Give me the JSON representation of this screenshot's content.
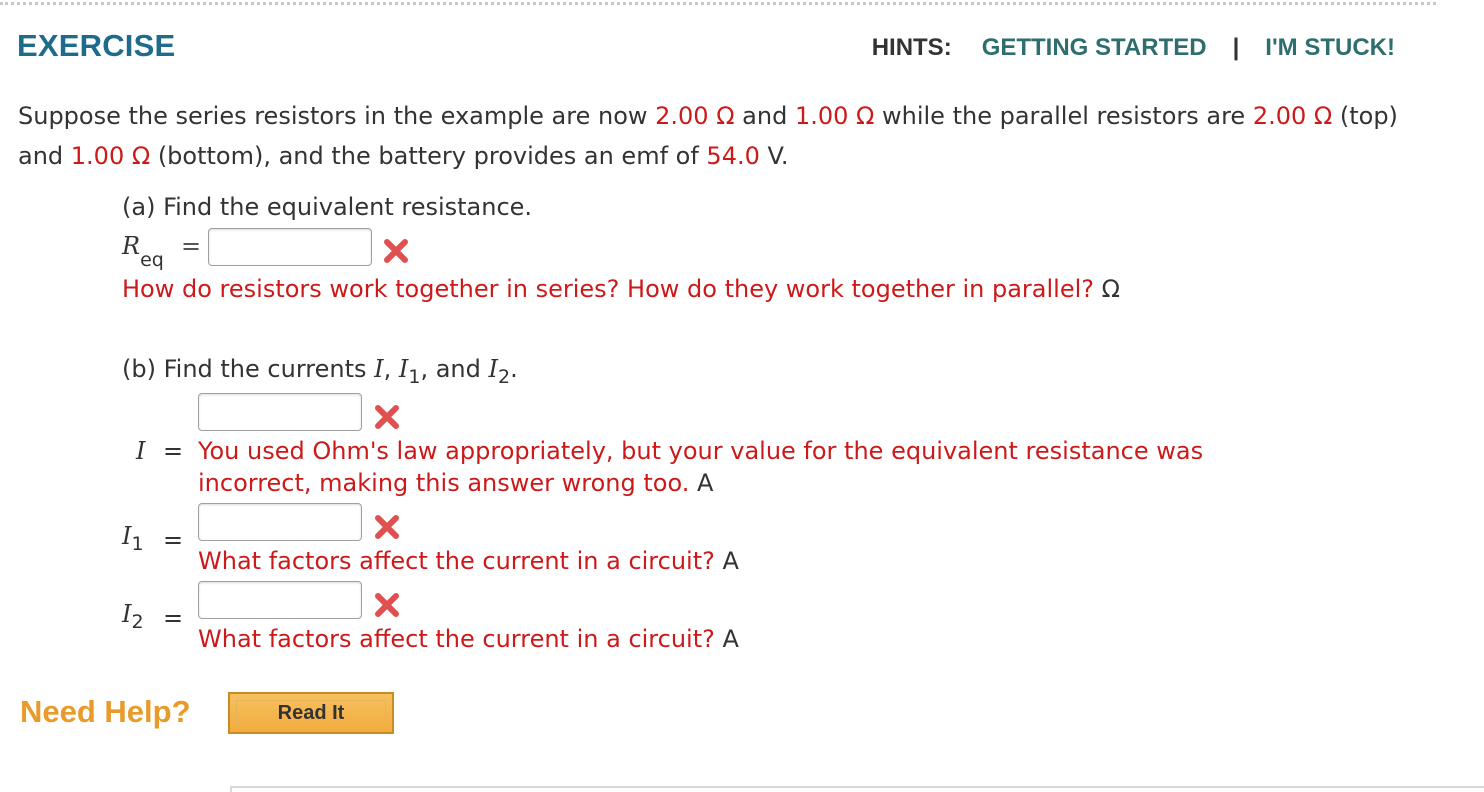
{
  "header": {
    "title": "EXERCISE",
    "hints_label": "HINTS:",
    "getting_started": "GETTING STARTED",
    "separator": "|",
    "im_stuck": "I'M STUCK!"
  },
  "question": {
    "t1": "Suppose the series resistors in the example are now ",
    "v1": "2.00 Ω",
    "t2": " and ",
    "v2": "1.00 Ω",
    "t3": " while the parallel resistors are ",
    "v3": "2.00 Ω",
    "t4": " (top) and ",
    "v4": "1.00 Ω",
    "t5": " (bottom), and the battery provides an emf of ",
    "v5": "54.0",
    "t6": " V."
  },
  "part_a": {
    "prompt": "(a) Find the equivalent resistance.",
    "var": "R",
    "var_sub": "eq",
    "equals": "=",
    "input_value": "",
    "feedback": "How do resistors work together in series? How do they work together in parallel?",
    "unit": "Ω"
  },
  "part_b": {
    "prompt_start": "(b) Find the currents ",
    "var_I": "I",
    "comma": ", ",
    "var_I1": "I",
    "sub1": "1",
    "and": ", and ",
    "var_I2": "I",
    "sub2": "2",
    "period": ".",
    "I": {
      "label": "I",
      "equals": "=",
      "input_value": "",
      "feedback_line1": "You used Ohm's law appropriately, but your value for the equivalent resistance was",
      "feedback_line2": "incorrect, making this answer wrong too.",
      "unit": "A"
    },
    "I1": {
      "label": "I",
      "sub": "1",
      "equals": "=",
      "input_value": "",
      "feedback": "What factors affect the current in a circuit?",
      "unit": "A"
    },
    "I2": {
      "label": "I",
      "sub": "2",
      "equals": "=",
      "input_value": "",
      "feedback": "What factors affect the current in a circuit?",
      "unit": "A"
    }
  },
  "help": {
    "need_help": "Need Help?",
    "read_it": "Read It"
  },
  "colors": {
    "title": "#1e6b8c",
    "link": "#2e6e6e",
    "error_red": "#cc1a1a",
    "need_help": "#e89a2a",
    "button": "#f2ac3e"
  },
  "icons": {
    "incorrect": "red-x-icon"
  }
}
